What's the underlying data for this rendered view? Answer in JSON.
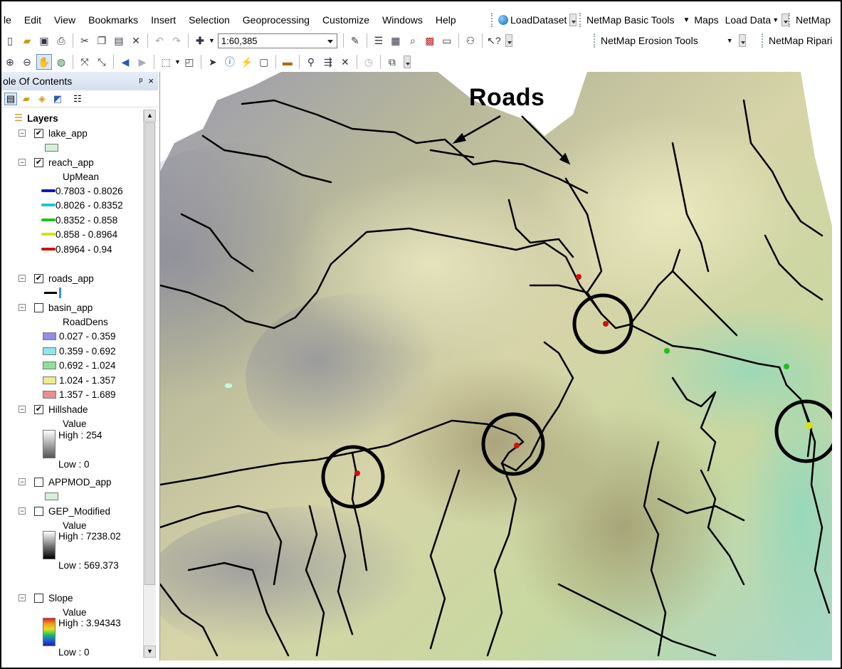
{
  "menu": [
    "le",
    "Edit",
    "View",
    "Bookmarks",
    "Insert",
    "Selection",
    "Geoprocessing",
    "Customize",
    "Windows",
    "Help"
  ],
  "toolbar_right": {
    "load_dataset": "LoadDataset",
    "netmap_basic": "NetMap Basic Tools",
    "maps": "Maps",
    "load_data": "Load Data",
    "netmap_trunc": "NetMap",
    "netmap_erosion": "NetMap Erosion Tools",
    "netmap_riparian": "NetMap Ripari"
  },
  "scale": "1:60,385",
  "toc": {
    "title": "ole Of Contents",
    "pin": "ᵖ",
    "close": "×",
    "root": "Layers",
    "lake": {
      "name": "lake_app",
      "color": "#d4f0d8"
    },
    "reach": {
      "name": "reach_app",
      "field": "UpMean",
      "classes": [
        {
          "label": "0.7803 - 0.8026",
          "color": "#1018c0"
        },
        {
          "label": "0.8026 - 0.8352",
          "color": "#18c8d0"
        },
        {
          "label": "0.8352 - 0.858",
          "color": "#20c020"
        },
        {
          "label": "0.858 - 0.8964",
          "color": "#d8e010"
        },
        {
          "label": "0.8964 - 0.94",
          "color": "#d01010"
        }
      ]
    },
    "roads": {
      "name": "roads_app"
    },
    "basin": {
      "name": "basin_app",
      "field": "RoadDens",
      "classes": [
        {
          "label": "0.027 - 0.359",
          "color": "#8f8fe8"
        },
        {
          "label": "0.359 - 0.692",
          "color": "#8fe6e8"
        },
        {
          "label": "0.692 - 1.024",
          "color": "#8fe09a"
        },
        {
          "label": "1.024 - 1.357",
          "color": "#ecec8a"
        },
        {
          "label": "1.357 - 1.689",
          "color": "#e89090"
        }
      ]
    },
    "hillshade": {
      "name": "Hillshade",
      "value": "Value",
      "high": "High : 254",
      "low": "Low : 0"
    },
    "appmod": {
      "name": "APPMOD_app",
      "color": "#d4f0d8"
    },
    "gep": {
      "name": "GEP_Modified",
      "value": "Value",
      "high": "High : 7238.02",
      "low": "Low : 569.373"
    },
    "slope": {
      "name": "Slope",
      "value": "Value",
      "high": "High : 3.94343",
      "low": "Low : 0"
    }
  },
  "map": {
    "annotation": "Roads"
  }
}
